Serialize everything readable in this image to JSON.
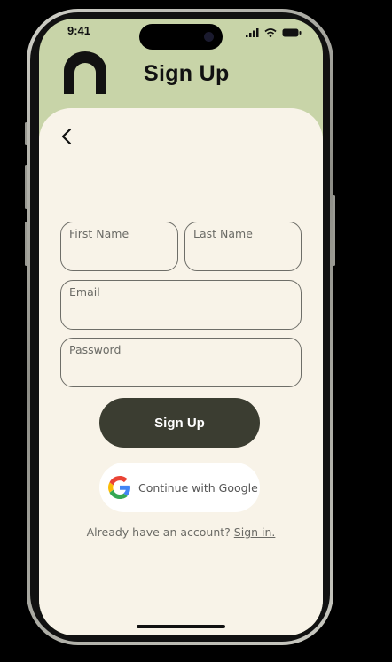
{
  "status_bar": {
    "time": "9:41",
    "icons": [
      "signal-icon",
      "wifi-icon",
      "battery-icon"
    ]
  },
  "header": {
    "title": "Sign Up",
    "logo_icon": "n-arch-logo"
  },
  "back_icon": "chevron-left-icon",
  "form": {
    "first_name_label": "First Name",
    "last_name_label": "Last Name",
    "email_label": "Email",
    "password_label": "Password"
  },
  "actions": {
    "sign_up_label": "Sign Up",
    "google_label": "Continue with Google",
    "google_icon": "google-icon"
  },
  "footer": {
    "prompt": "Already have an account?",
    "link": "Sign in."
  },
  "colors": {
    "header_bg": "#c8d4a8",
    "card_bg": "#f8f3e8",
    "primary_button": "#3b3d31",
    "text_muted": "#6b6b66"
  }
}
